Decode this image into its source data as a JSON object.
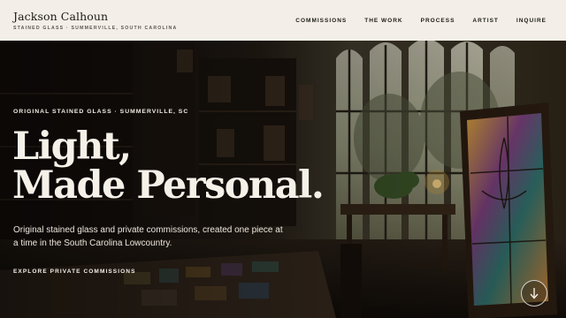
{
  "brand": {
    "name": "Jackson Calhoun",
    "tagline": "Stained Glass · Summerville, South Carolina"
  },
  "nav": {
    "items": [
      {
        "label": "Commissions"
      },
      {
        "label": "The Work"
      },
      {
        "label": "Process"
      },
      {
        "label": "Artist"
      },
      {
        "label": "Inquire"
      }
    ]
  },
  "hero": {
    "eyebrow": "Original Stained Glass · Summerville, SC",
    "headline_line1": "Light,",
    "headline_line2": "Made Personal.",
    "lede": "Original stained glass and private commissions, created one piece at a time in the South Carolina Lowcountry.",
    "cta_label": "Explore Private Commissions",
    "scroll_icon": "arrow-down-icon"
  },
  "colors": {
    "header_bg": "#f3efe8",
    "text_dark": "#1d1a16",
    "hero_text": "#f6f1e8"
  }
}
